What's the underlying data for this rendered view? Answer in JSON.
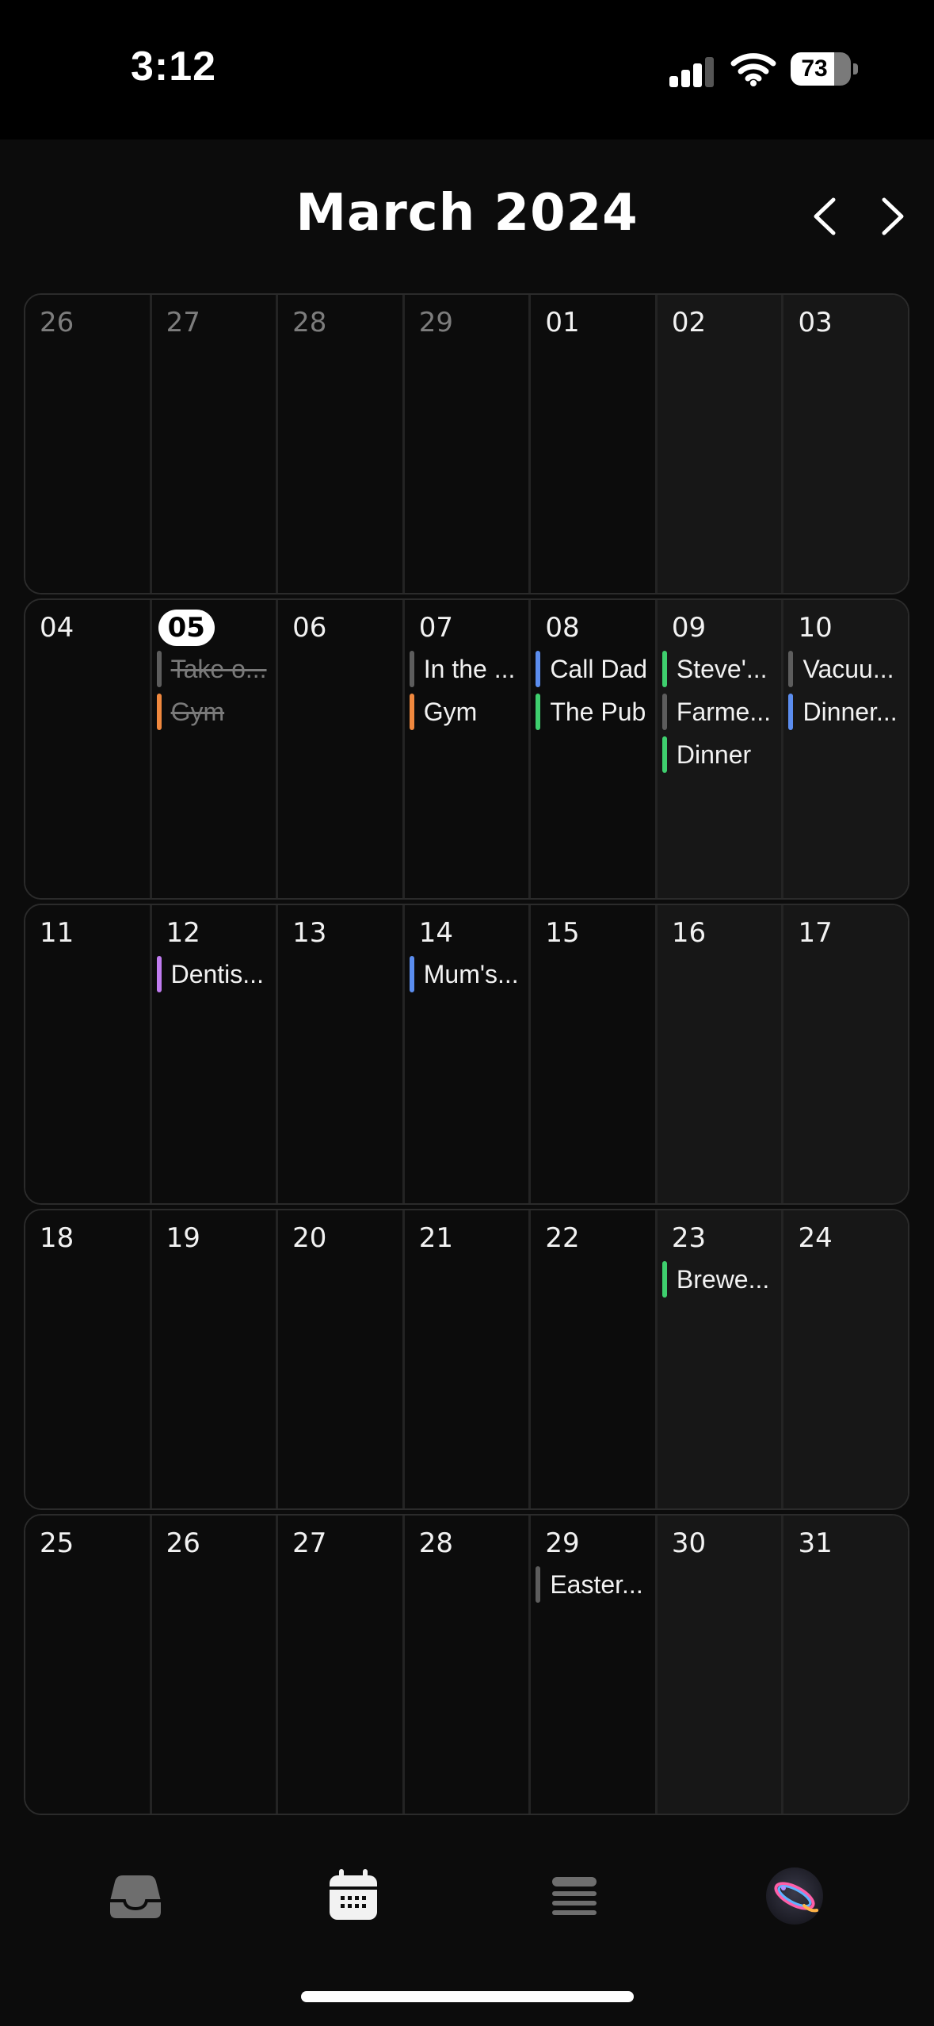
{
  "status_bar": {
    "time": "3:12",
    "battery": "73",
    "battery_level": 0.73
  },
  "header": {
    "title": "March 2024",
    "prev_icon": "chevron-left-icon",
    "next_icon": "chevron-right-icon"
  },
  "colors": {
    "blue": "#5b8def",
    "green": "#3ecf6e",
    "orange": "#f0883e",
    "gray": "#5d5d5d",
    "purple": "#c07cf0"
  },
  "weeks": [
    {
      "days": [
        {
          "num": "26",
          "muted": true,
          "events": []
        },
        {
          "num": "27",
          "muted": true,
          "events": []
        },
        {
          "num": "28",
          "muted": true,
          "events": []
        },
        {
          "num": "29",
          "muted": true,
          "events": []
        },
        {
          "num": "01",
          "events": []
        },
        {
          "num": "02",
          "weekend": true,
          "events": []
        },
        {
          "num": "03",
          "weekend": true,
          "events": []
        }
      ]
    },
    {
      "days": [
        {
          "num": "04",
          "events": []
        },
        {
          "num": "05",
          "today": true,
          "events": [
            {
              "title": "Take o...",
              "color": "gray",
              "done": true
            },
            {
              "title": "Gym",
              "color": "orange",
              "done": true
            }
          ]
        },
        {
          "num": "06",
          "events": []
        },
        {
          "num": "07",
          "events": [
            {
              "title": "In the ...",
              "color": "gray"
            },
            {
              "title": "Gym",
              "color": "orange"
            }
          ]
        },
        {
          "num": "08",
          "events": [
            {
              "title": "Call Dad",
              "color": "blue"
            },
            {
              "title": "The Pub",
              "color": "green"
            }
          ]
        },
        {
          "num": "09",
          "weekend": true,
          "events": [
            {
              "title": "Steve'...",
              "color": "green"
            },
            {
              "title": "Farme...",
              "color": "gray"
            },
            {
              "title": "Dinner",
              "color": "green"
            }
          ]
        },
        {
          "num": "10",
          "weekend": true,
          "events": [
            {
              "title": "Vacuu...",
              "color": "gray"
            },
            {
              "title": "Dinner...",
              "color": "blue"
            }
          ]
        }
      ]
    },
    {
      "days": [
        {
          "num": "11",
          "events": []
        },
        {
          "num": "12",
          "events": [
            {
              "title": "Dentis...",
              "color": "purple"
            }
          ]
        },
        {
          "num": "13",
          "events": []
        },
        {
          "num": "14",
          "events": [
            {
              "title": "Mum's...",
              "color": "blue"
            }
          ]
        },
        {
          "num": "15",
          "events": []
        },
        {
          "num": "16",
          "weekend": true,
          "events": []
        },
        {
          "num": "17",
          "weekend": true,
          "events": []
        }
      ]
    },
    {
      "days": [
        {
          "num": "18",
          "events": []
        },
        {
          "num": "19",
          "events": []
        },
        {
          "num": "20",
          "events": []
        },
        {
          "num": "21",
          "events": []
        },
        {
          "num": "22",
          "events": []
        },
        {
          "num": "23",
          "weekend": true,
          "events": [
            {
              "title": "Brewe...",
              "color": "green"
            }
          ]
        },
        {
          "num": "24",
          "weekend": true,
          "events": []
        }
      ]
    },
    {
      "days": [
        {
          "num": "25",
          "events": []
        },
        {
          "num": "26",
          "events": []
        },
        {
          "num": "27",
          "events": []
        },
        {
          "num": "28",
          "events": []
        },
        {
          "num": "29",
          "events": [
            {
              "title": "Easter...",
              "color": "gray"
            }
          ]
        },
        {
          "num": "30",
          "weekend": true,
          "events": []
        },
        {
          "num": "31",
          "weekend": true,
          "events": []
        }
      ]
    }
  ],
  "tabs": [
    {
      "name": "inbox-icon",
      "active": false
    },
    {
      "name": "calendar-icon",
      "active": true
    },
    {
      "name": "list-icon",
      "active": false
    },
    {
      "name": "ai-assistant-icon",
      "active": false
    }
  ]
}
